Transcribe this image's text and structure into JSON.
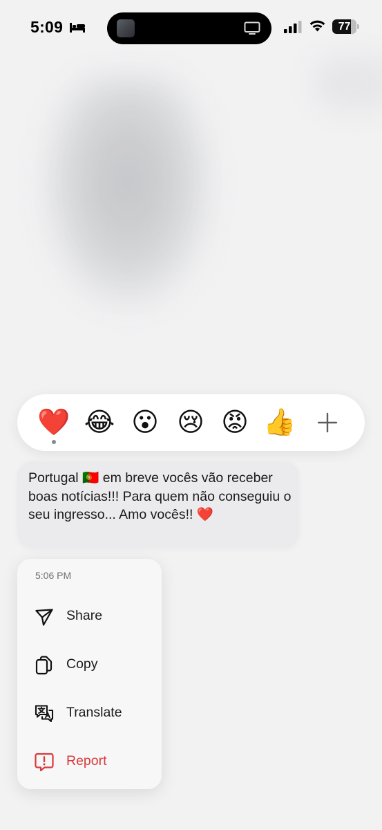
{
  "status_bar": {
    "time": "5:09",
    "battery_percent": "77",
    "battery_level": 0.77
  },
  "reactions": {
    "items": [
      {
        "name": "heart",
        "emoji": "❤️",
        "selected": true
      },
      {
        "name": "tears-of-joy",
        "emoji": "😂",
        "selected": false
      },
      {
        "name": "surprised",
        "emoji": "😮",
        "selected": false
      },
      {
        "name": "crying",
        "emoji": "😢",
        "selected": false
      },
      {
        "name": "angry",
        "emoji": "😡",
        "selected": false
      },
      {
        "name": "thumbs-up",
        "emoji": "👍",
        "selected": false
      }
    ],
    "more_icon": "plus-icon"
  },
  "message": {
    "text": "Portugal 🇵🇹 em breve vocês vão receber boas notícias!!! Para quem não conseguiu o seu ingresso... Amo vocês!! ❤️"
  },
  "context_menu": {
    "timestamp": "5:06 PM",
    "items": [
      {
        "label": "Share",
        "icon": "share-icon"
      },
      {
        "label": "Copy",
        "icon": "copy-icon"
      },
      {
        "label": "Translate",
        "icon": "translate-icon"
      },
      {
        "label": "Report",
        "icon": "report-icon",
        "color": "#d83a3a"
      }
    ]
  },
  "colors": {
    "danger": "#d83a3a",
    "background": "#f2f2f3"
  }
}
